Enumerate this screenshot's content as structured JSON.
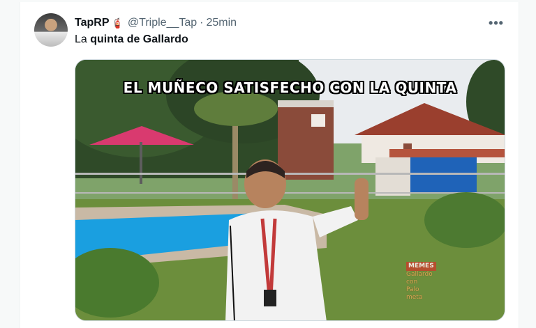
{
  "tweet": {
    "display_name": "TapRP",
    "badge_icon": "fire-extinguisher-emoji",
    "handle": "@Triple__Tap",
    "separator": "·",
    "time": "25min",
    "text_prefix": "La ",
    "text_bold": "quinta de Gallardo",
    "more_label": "•••"
  },
  "media": {
    "caption": "EL MUÑECO SATISFECHO CON LA QUINTA",
    "watermark": {
      "top": "MEMES",
      "line1": "Gallardo",
      "line2": "con",
      "line3": "Palo",
      "line4": "meta"
    }
  },
  "colors": {
    "text_primary": "#0f1419",
    "text_secondary": "#536471",
    "border": "#cfd9de"
  }
}
